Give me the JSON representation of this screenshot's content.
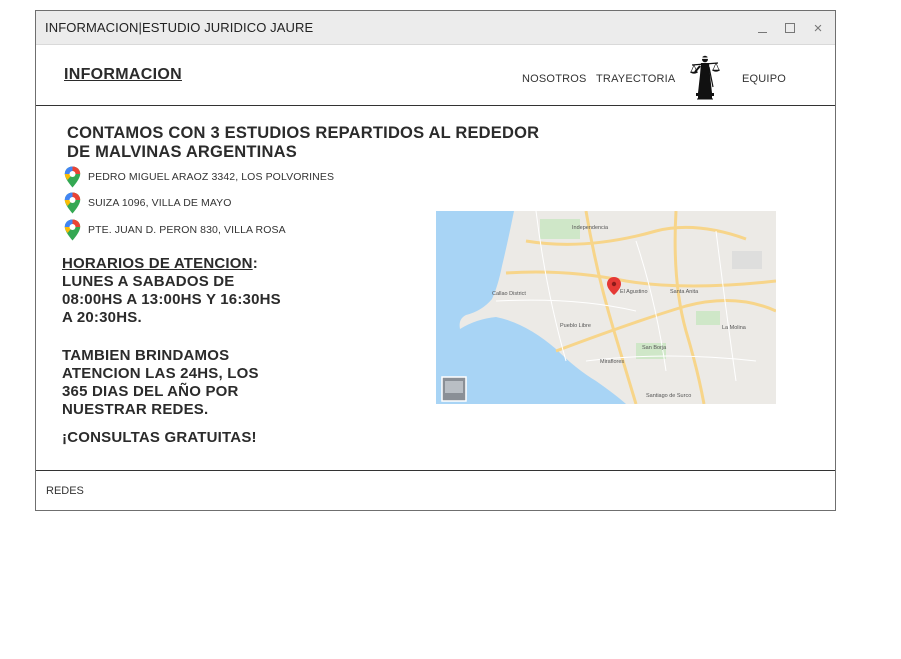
{
  "window": {
    "title": "INFORMACION|ESTUDIO JURIDICO JAURE",
    "controls": [
      "minimize-icon",
      "maximize-icon",
      "close-icon"
    ]
  },
  "navbar": {
    "brand": "INFORMACION",
    "links": [
      "NOSOTROS",
      "TRAYECTORIA",
      "EQUIPO"
    ],
    "logo_icon": "lady-justice-icon"
  },
  "main": {
    "headline": "CONTAMOS CON 3 ESTUDIOS REPARTIDOS AL REDEDOR DE MALVINAS ARGENTINAS",
    "locations": [
      {
        "icon": "map-pin-icon",
        "address": "PEDRO MIGUEL ARAOZ 3342, LOS POLVORINES"
      },
      {
        "icon": "map-pin-icon",
        "address": "SUIZA 1096, VILLA DE MAYO"
      },
      {
        "icon": "map-pin-icon",
        "address": "PTE. JUAN D. PERON 830, VILLA ROSA"
      }
    ],
    "hours_title": "HORARIOS DE ATENCION",
    "hours_colon": ":",
    "hours_text": "LUNES A SABADOS DE 08:00HS A 13:00HS Y 16:30HS A 20:30HS.",
    "available_text": "TAMBIEN BRINDAMOS ATENCION LAS 24HS, LOS 365 DIAS DEL AÑO POR NUESTRAR REDES.",
    "free_text": "¡CONSULTAS GRATUITAS!"
  },
  "map": {
    "labels": [
      "Independencia",
      "Callao District",
      "Pueblo Libre",
      "Miraflores",
      "Santiago de Surco",
      "El Agustino",
      "Santa Anita",
      "La Molina",
      "San Borja"
    ],
    "colors": {
      "sea": "#a8d4f5",
      "land": "#eceae6",
      "road": "#f7d58a",
      "park": "#c8e6c0",
      "marker": "#e53935"
    }
  },
  "footer": {
    "label": "REDES"
  }
}
